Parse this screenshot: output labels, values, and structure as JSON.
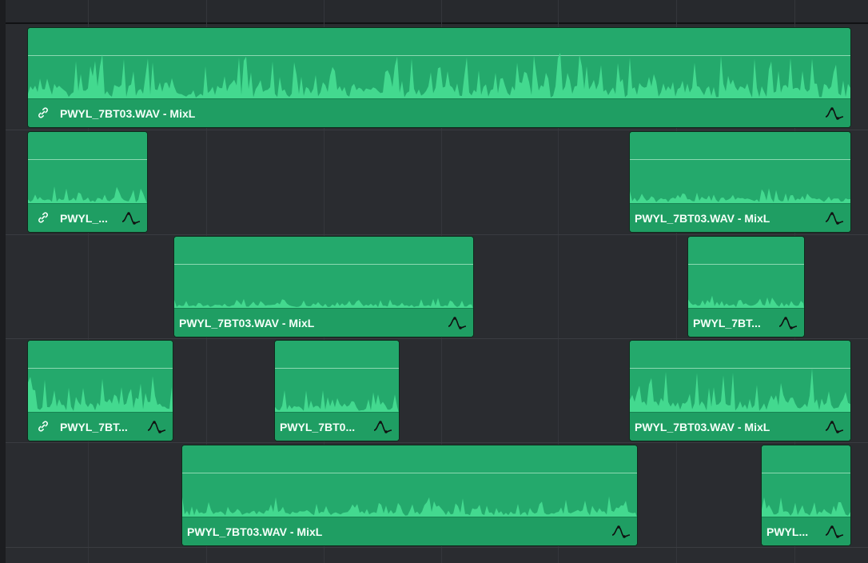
{
  "timeline": {
    "clips": [
      {
        "id": "c1",
        "label": "PWYL_7BT03.WAV - MixL",
        "linked": true
      },
      {
        "id": "c2",
        "label": "PWYL_...",
        "linked": true
      },
      {
        "id": "c3",
        "label": "PWYL_7BT03.WAV - MixL",
        "linked": false
      },
      {
        "id": "c4",
        "label": "PWYL_7BT03.WAV - MixL",
        "linked": false
      },
      {
        "id": "c5",
        "label": "PWYL_7BT...",
        "linked": false
      },
      {
        "id": "c6",
        "label": "PWYL_7BT...",
        "linked": true
      },
      {
        "id": "c7",
        "label": "PWYL_7BT0...",
        "linked": false
      },
      {
        "id": "c8",
        "label": "PWYL_7BT03.WAV - MixL",
        "linked": false
      },
      {
        "id": "c9",
        "label": "PWYL_7BT03.WAV - MixL",
        "linked": false
      },
      {
        "id": "c10",
        "label": "PWYL...",
        "linked": false
      }
    ]
  },
  "icons": {
    "link": "link-icon",
    "fade_curve": "volume-curve-icon"
  },
  "colors": {
    "clip_fill": "#1d9e62",
    "waveform": "#43d98f",
    "background": "#2a2c30"
  }
}
